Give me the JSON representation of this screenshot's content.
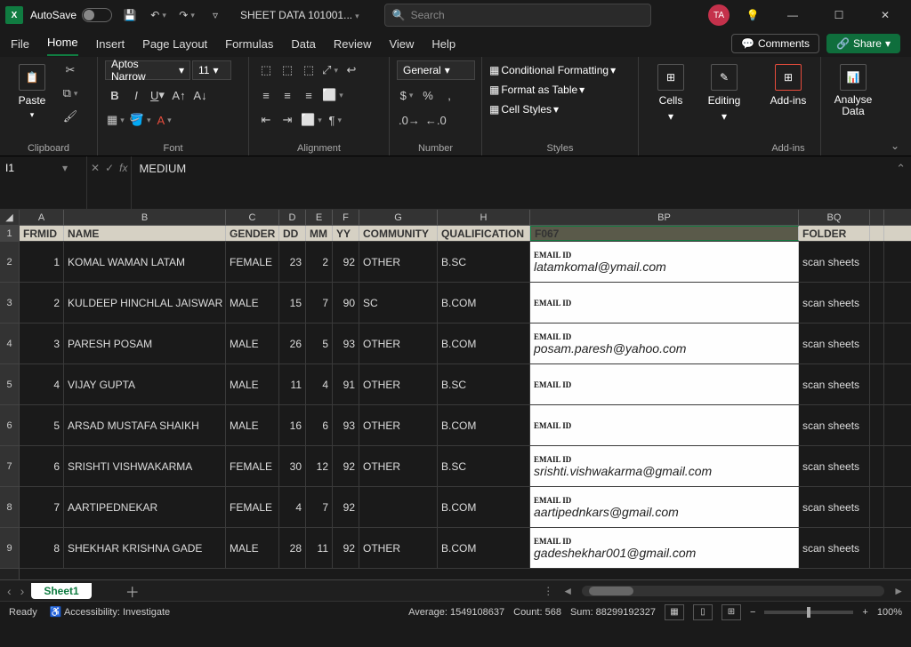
{
  "titlebar": {
    "autosave": "AutoSave",
    "doc": "SHEET DATA 101001...",
    "search_placeholder": "Search",
    "avatar": "TA"
  },
  "tabs": {
    "file": "File",
    "home": "Home",
    "insert": "Insert",
    "pagelayout": "Page Layout",
    "formulas": "Formulas",
    "data": "Data",
    "review": "Review",
    "view": "View",
    "help": "Help",
    "comments": "Comments",
    "share": "Share"
  },
  "ribbon": {
    "paste": "Paste",
    "font_name": "Aptos Narrow",
    "font_size": "11",
    "number_format": "General",
    "cond_fmt": "Conditional Formatting",
    "as_table": "Format as Table",
    "cell_styles": "Cell Styles",
    "cells": "Cells",
    "editing": "Editing",
    "addins": "Add-ins",
    "analyse": "Analyse Data",
    "groups": {
      "clipboard": "Clipboard",
      "font": "Font",
      "alignment": "Alignment",
      "number": "Number",
      "styles": "Styles",
      "addins": "Add-ins"
    }
  },
  "formula": {
    "namebox": "I1",
    "value": "MEDIUM"
  },
  "columns": {
    "A": "A",
    "B": "B",
    "C": "C",
    "D": "D",
    "E": "E",
    "F": "F",
    "G": "G",
    "H": "H",
    "BP": "BP",
    "BQ": "BQ"
  },
  "headers": {
    "frmid": "FRMID",
    "name": "NAME",
    "gender": "GENDER",
    "dd": "DD",
    "mm": "MM",
    "yy": "YY",
    "community": "COMMUNITY",
    "qualification": "QUALIFICATION",
    "f067": "F067",
    "folder": "FOLDER"
  },
  "rowlabels": [
    "1",
    "2",
    "3",
    "4",
    "5",
    "6",
    "7",
    "8",
    "9"
  ],
  "rows": [
    {
      "frmid": "1",
      "name": "KOMAL  WAMAN  LATAM",
      "gender": "FEMALE",
      "dd": "23",
      "mm": "2",
      "yy": "92",
      "community": "OTHER",
      "qual": "B.SC",
      "email": "latamkomal@ymail.com",
      "folder": "scan sheets"
    },
    {
      "frmid": "2",
      "name": "KULDEEP HINCHLAL JAISWAR",
      "gender": "MALE",
      "dd": "15",
      "mm": "7",
      "yy": "90",
      "community": "SC",
      "qual": "B.COM",
      "email": "",
      "folder": "scan sheets"
    },
    {
      "frmid": "3",
      "name": "PARESH POSAM",
      "gender": "MALE",
      "dd": "26",
      "mm": "5",
      "yy": "93",
      "community": "OTHER",
      "qual": "B.COM",
      "email": "posam.paresh@yahoo.com",
      "folder": "scan sheets"
    },
    {
      "frmid": "4",
      "name": "VIJAY GUPTA",
      "gender": "MALE",
      "dd": "11",
      "mm": "4",
      "yy": "91",
      "community": "OTHER",
      "qual": "B.SC",
      "email": "",
      "folder": "scan sheets"
    },
    {
      "frmid": "5",
      "name": "ARSAD MUSTAFA SHAIKH",
      "gender": "MALE",
      "dd": "16",
      "mm": "6",
      "yy": "93",
      "community": "OTHER",
      "qual": "B.COM",
      "email": "",
      "folder": "scan sheets"
    },
    {
      "frmid": "6",
      "name": "SRISHTI VISHWAKARMA",
      "gender": "FEMALE",
      "dd": "30",
      "mm": "12",
      "yy": "92",
      "community": "OTHER",
      "qual": "B.SC",
      "email": "srishti.vishwakarma@gmail.com",
      "folder": "scan sheets"
    },
    {
      "frmid": "7",
      "name": "AARTIPEDNEKAR",
      "gender": "FEMALE",
      "dd": "4",
      "mm": "7",
      "yy": "92",
      "community": "",
      "qual": "B.COM",
      "email": "aartipednkars@gmail.com",
      "folder": "scan sheets"
    },
    {
      "frmid": "8",
      "name": "SHEKHAR KRISHNA GADE",
      "gender": "MALE",
      "dd": "28",
      "mm": "11",
      "yy": "92",
      "community": "OTHER",
      "qual": "B.COM",
      "email": "gadeshekhar001@gmail.com",
      "folder": "scan sheets"
    }
  ],
  "email_label": "EMAIL ID",
  "sheet": {
    "name": "Sheet1"
  },
  "status": {
    "ready": "Ready",
    "accessibility": "Accessibility: Investigate",
    "average": "Average: 1549108637",
    "count": "Count: 568",
    "sum": "Sum: 88299192327",
    "zoom": "100%"
  }
}
